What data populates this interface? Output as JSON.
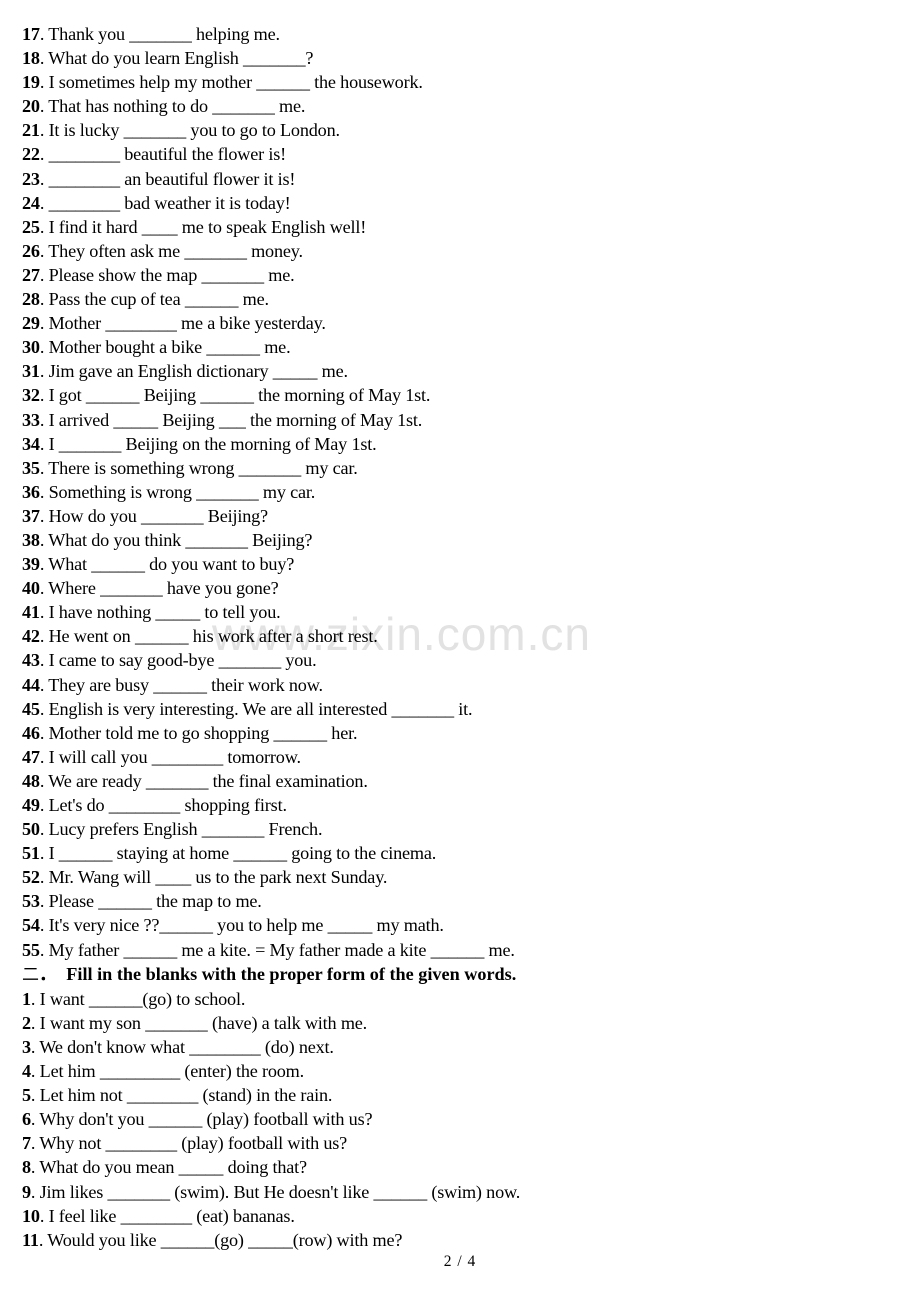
{
  "document": {
    "watermark_text": "www.zixin.com.cn",
    "watermark_color": "#e2e2e2",
    "page_footer": "2  / 4",
    "background_color": "#ffffff",
    "text_color": "#000000"
  },
  "section_one": {
    "questions": [
      {
        "num": "17",
        "text": "Thank you _______ helping me."
      },
      {
        "num": "18",
        "text": "What do you learn English _______?"
      },
      {
        "num": "19",
        "text": "I sometimes help my mother ______ the housework."
      },
      {
        "num": "20",
        "text": "That has nothing to do _______ me."
      },
      {
        "num": "21",
        "text": "It is lucky _______ you to go to London."
      },
      {
        "num": "22",
        "text": "________ beautiful the flower is!"
      },
      {
        "num": "23",
        "text": "________ an beautiful flower it is!"
      },
      {
        "num": "24",
        "text": "________ bad weather it is today!"
      },
      {
        "num": "25",
        "text": "I find it hard ____ me to speak English well!"
      },
      {
        "num": "26",
        "text": "They often ask me _______ money."
      },
      {
        "num": "27",
        "text": "Please show the map _______ me."
      },
      {
        "num": "28",
        "text": "Pass the cup of tea ______ me."
      },
      {
        "num": "29",
        "text": "Mother ________ me a bike yesterday."
      },
      {
        "num": "30",
        "text": "Mother bought a bike ______ me."
      },
      {
        "num": "31",
        "text": "Jim gave an English dictionary _____ me."
      },
      {
        "num": "32",
        "text": "I got ______ Beijing ______ the morning of May 1st.",
        "bold_spans": [
          "1"
        ]
      },
      {
        "num": "33",
        "text": "I arrived _____ Beijing ___ the morning of May 1st.",
        "bold_spans": [
          "1"
        ]
      },
      {
        "num": "34",
        "text": "I _______ Beijing on the morning of May 1st.",
        "bold_spans": [
          "1"
        ]
      },
      {
        "num": "35",
        "text": "There is something wrong _______ my car."
      },
      {
        "num": "36",
        "text": "Something is wrong _______ my car."
      },
      {
        "num": "37",
        "text": "How do you _______ Beijing?"
      },
      {
        "num": "38",
        "text": "What do you think _______ Beijing?"
      },
      {
        "num": "39",
        "text": "What ______ do you want to buy?"
      },
      {
        "num": "40",
        "text": "Where _______ have you gone?"
      },
      {
        "num": "41",
        "text": "I have nothing _____ to tell you."
      },
      {
        "num": "42",
        "text": "He went on ______ his work after a short rest."
      },
      {
        "num": "43",
        "text": "I came to say good-bye _______ you."
      },
      {
        "num": "44",
        "text": "They are busy ______ their work now."
      },
      {
        "num": "45",
        "text": "English is very interesting. We are all interested _______ it."
      },
      {
        "num": "46",
        "text": "Mother told me to go shopping ______ her."
      },
      {
        "num": "47",
        "text": "I will call you ________ tomorrow."
      },
      {
        "num": "48",
        "text": "We are ready _______ the final examination."
      },
      {
        "num": "49",
        "text": "Let's do ________ shopping first."
      },
      {
        "num": "50",
        "text": "Lucy prefers English _______ French."
      },
      {
        "num": "51",
        "text": "I ______ staying at home ______ going to the cinema."
      },
      {
        "num": "52",
        "text": "Mr. Wang will ____ us to the park next Sunday."
      },
      {
        "num": "53",
        "text": "Please ______ the map to me."
      },
      {
        "num": "54",
        "text": "It's very nice ??______ you to help me _____ my math."
      },
      {
        "num": "55",
        "text": "My father ______ me a kite. = My father made a kite ______ me."
      }
    ]
  },
  "section_two": {
    "marker": "二",
    "marker_punct": "．",
    "title": "Fill in the blanks with the proper form of the given words.",
    "questions": [
      {
        "num": "1",
        "text": "I want ______(go) to school."
      },
      {
        "num": "2",
        "text": "I want my son _______ (have) a talk with me."
      },
      {
        "num": "3",
        "text": "We don't know what ________ (do) next."
      },
      {
        "num": "4",
        "text": "Let him _________ (enter) the room."
      },
      {
        "num": "5",
        "text": "Let him not ________ (stand) in the rain."
      },
      {
        "num": "6",
        "text": "Why don't you ______ (play) football with us?"
      },
      {
        "num": "7",
        "text": "Why not ________ (play) football with us?"
      },
      {
        "num": "8",
        "text": "What do you mean _____ doing that?"
      },
      {
        "num": "9",
        "text": "Jim likes _______ (swim). But He doesn't like ______ (swim) now."
      },
      {
        "num": "10",
        "text": "I feel like ________ (eat) bananas."
      },
      {
        "num": "11",
        "text": "Would you like ______(go) _____(row) with me?"
      }
    ]
  }
}
